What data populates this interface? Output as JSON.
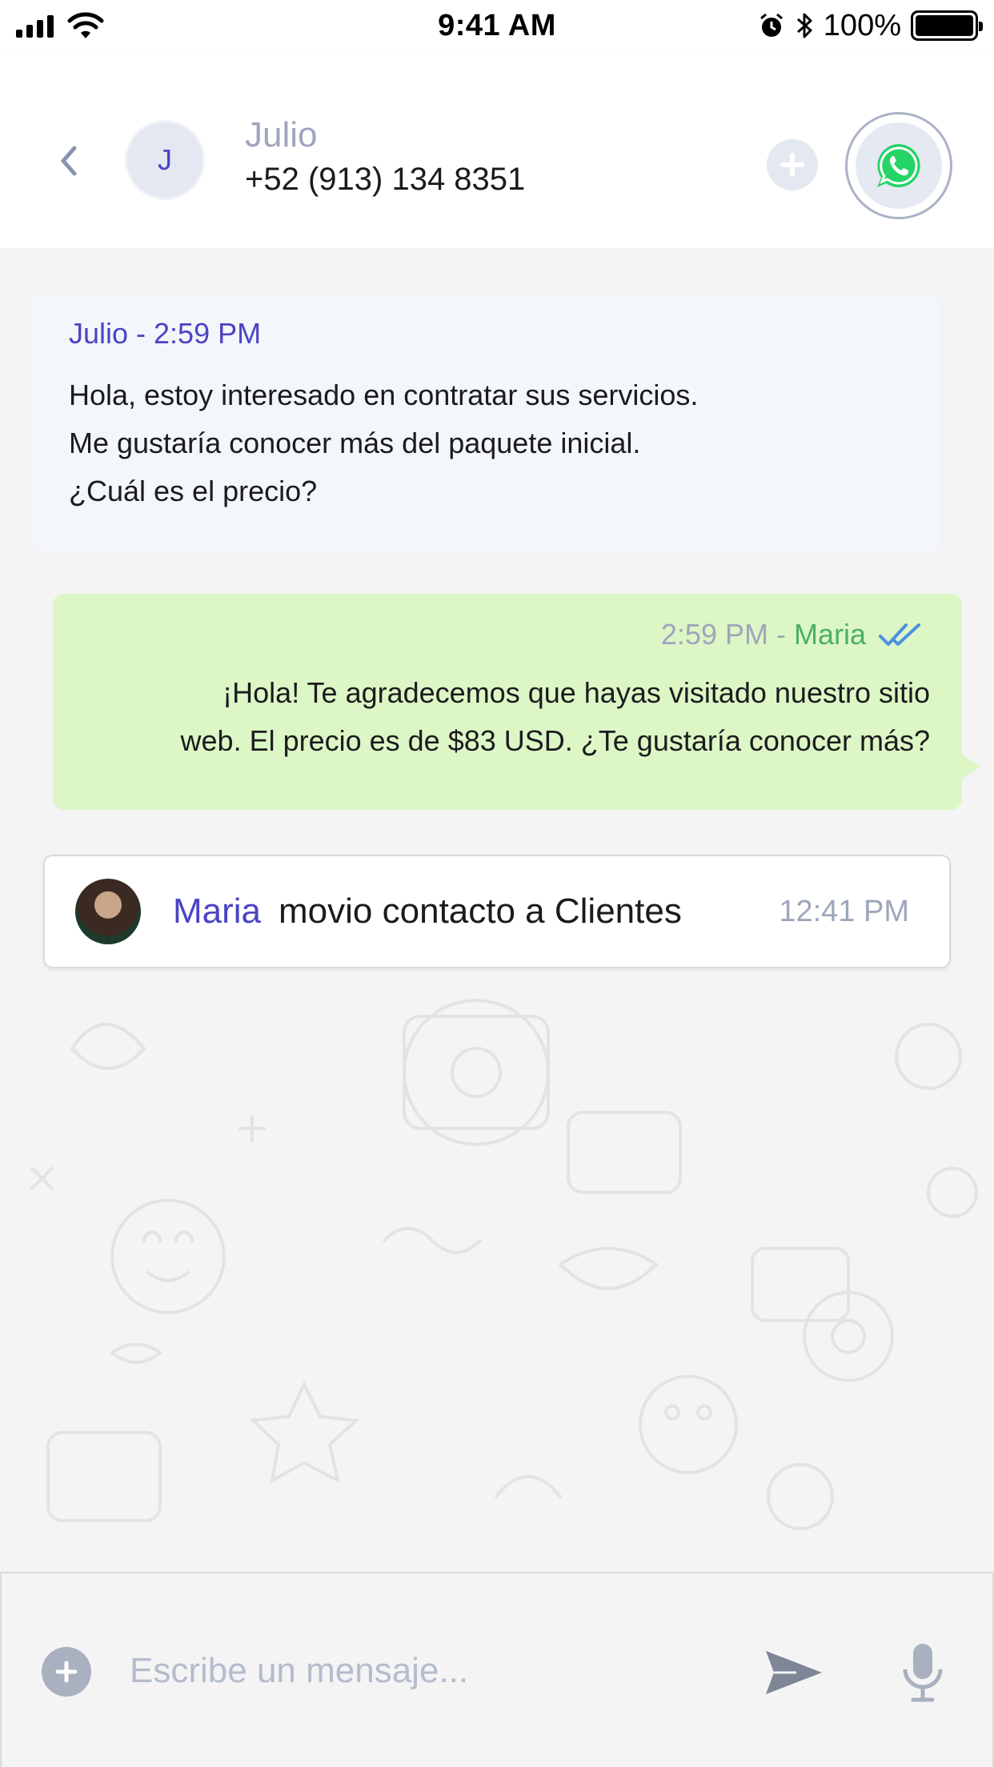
{
  "status_bar": {
    "time": "9:41 AM",
    "battery": "100%",
    "battery_level": 1.0,
    "icons": [
      "signal-icon",
      "wifi-icon",
      "alarm-icon",
      "bluetooth-icon",
      "battery-icon"
    ]
  },
  "header": {
    "avatar_initial": "J",
    "contact_name": "Julio",
    "contact_phone": "+52 (913) 134 8351",
    "icons": [
      "back-chevron-icon",
      "plus-icon",
      "whatsapp-icon"
    ]
  },
  "messages": [
    {
      "direction": "incoming",
      "meta": "Julio - 2:59 PM",
      "lines": [
        "Hola, estoy interesado en contratar sus servicios.",
        "Me gustaría conocer más del paquete inicial.",
        "¿Cuál es el precio?"
      ]
    },
    {
      "direction": "outgoing",
      "time": "2:59 PM - ",
      "author": "Maria",
      "lines": [
        "¡Hola! Te agradecemos que hayas visitado nuestro sitio",
        "web. El precio es de $83 USD. ¿Te gustaría conocer más?"
      ],
      "status_icon": "double-check-icon"
    }
  ],
  "event": {
    "user": "Maria",
    "text": "movio contacto a Clientes",
    "time": "12:41 PM"
  },
  "composer": {
    "placeholder": "Escribe un mensaje...",
    "icons": [
      "plus-icon",
      "send-icon",
      "microphone-icon"
    ]
  },
  "colors": {
    "accent": "#4a44c4",
    "outgoing_bubble": "#dcf7c5",
    "incoming_bubble": "#f3f6fa",
    "whatsapp_green": "#25d366",
    "muted": "#9ea6bc"
  }
}
